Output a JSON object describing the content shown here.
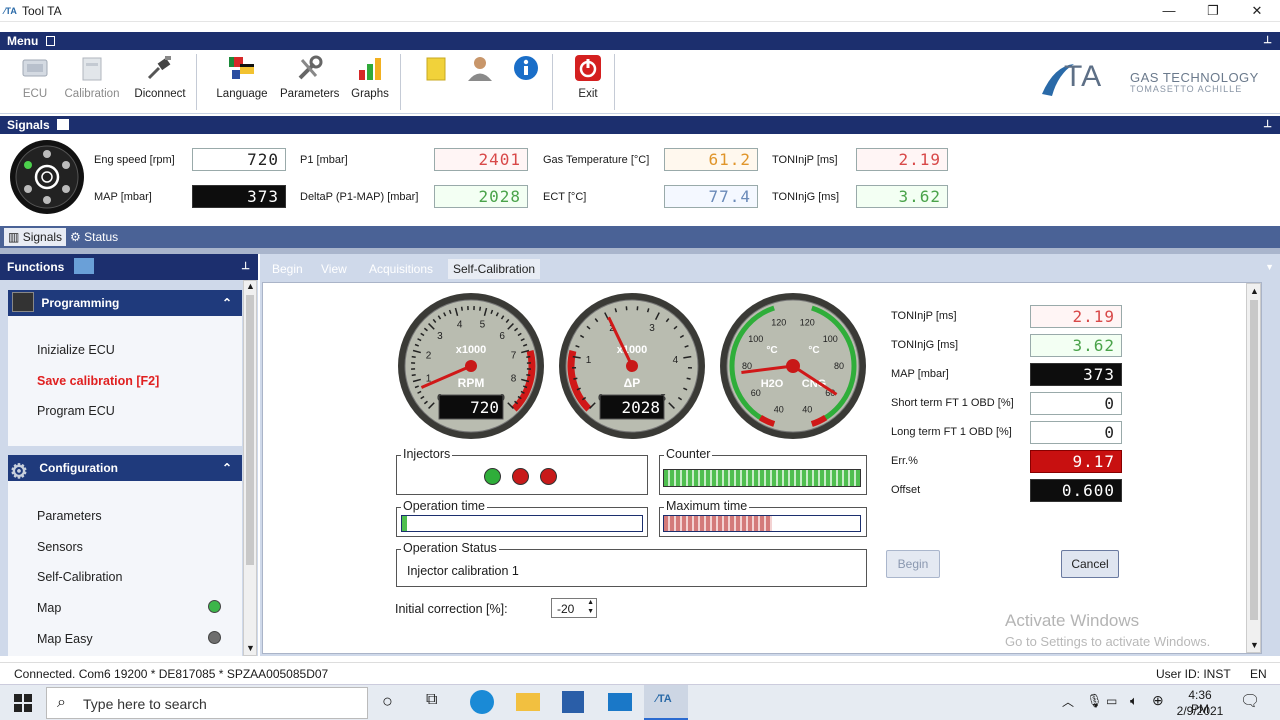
{
  "window": {
    "title": "Tool TA",
    "app_icon": "ta-app-icon"
  },
  "menu": {
    "header": "Menu",
    "tools": [
      {
        "id": "ecu",
        "label": "ECU",
        "icon": "ecu-icon",
        "enabled": false
      },
      {
        "id": "calibration",
        "label": "Calibration",
        "icon": "calibration-icon",
        "enabled": false
      },
      {
        "id": "disconnect",
        "label": "Diconnect",
        "icon": "disconnect-icon",
        "enabled": true
      },
      {
        "id": "language",
        "label": "Language",
        "icon": "language-flags-icon",
        "enabled": true
      },
      {
        "id": "parameters",
        "label": "Parameters",
        "icon": "wrench-icon",
        "enabled": true
      },
      {
        "id": "graphs",
        "label": "Graphs",
        "icon": "bar-graph-icon",
        "enabled": true
      },
      {
        "id": "folder",
        "label": "",
        "icon": "folder-icon",
        "enabled": true
      },
      {
        "id": "user",
        "label": "",
        "icon": "user-icon",
        "enabled": true
      },
      {
        "id": "info",
        "label": "",
        "icon": "info-icon",
        "enabled": true
      },
      {
        "id": "exit",
        "label": "Exit",
        "icon": "power-icon",
        "enabled": true
      }
    ],
    "logo": {
      "mark": "TA",
      "line1": "GAS TECHNOLOGY",
      "line2": "TOMASETTO ACHILLE"
    }
  },
  "signals": {
    "header": "Signals",
    "fields": {
      "eng_speed": {
        "label": "Eng speed [rpm]",
        "value": "720"
      },
      "map": {
        "label": "MAP [mbar]",
        "value": "373"
      },
      "p1": {
        "label": "P1 [mbar]",
        "value": "2401"
      },
      "deltap": {
        "label": "DeltaP (P1-MAP) [mbar]",
        "value": "2028"
      },
      "gas_temp": {
        "label": "Gas Temperature [°C]",
        "value": "61.2"
      },
      "ect": {
        "label": "ECT [°C]",
        "value": "77.4"
      },
      "toninjp": {
        "label": "TONInjP [ms]",
        "value": "2.19"
      },
      "toninjg": {
        "label": "TONInjG [ms]",
        "value": "3.62"
      }
    },
    "tabs": {
      "signals": "Signals",
      "status": "Status"
    }
  },
  "functions": {
    "header": "Functions",
    "programming": {
      "title": "Programming",
      "items": [
        "Inizialize ECU",
        "Save calibration [F2]",
        "Program ECU"
      ]
    },
    "configuration": {
      "title": "Configuration",
      "items": [
        "Parameters",
        "Sensors",
        "Self-Calibration",
        "Map",
        "Map Easy"
      ]
    },
    "status_colors": {
      "map": "#3cb54a",
      "map_easy": "#6e6e6e"
    }
  },
  "main": {
    "tabs": [
      "Begin",
      "View",
      "Acquisitions",
      "Self-Calibration"
    ],
    "gauges": {
      "rpm": {
        "unit": "x1000",
        "label": "RPM",
        "readout": "720",
        "ticks": [
          "0",
          "1",
          "2",
          "3",
          "4",
          "5",
          "6",
          "7",
          "8",
          "9"
        ],
        "fraction": 0.08
      },
      "dp": {
        "unit": "x1000",
        "label": "ΔP",
        "readout": "2028",
        "ticks": [
          "0",
          "1",
          "2",
          "3",
          "4",
          "5"
        ],
        "fraction": 0.405
      },
      "temp": {
        "left_label": "H2O",
        "right_label": "CNG",
        "left_unit": "°C",
        "right_unit": "°C",
        "left_ticks": [
          "40",
          "60",
          "80",
          "100",
          "120"
        ],
        "right_ticks": [
          "40",
          "60",
          "80",
          "100",
          "120"
        ],
        "left_fraction": 0.45,
        "right_fraction": 0.27
      }
    },
    "injectors": {
      "title": "Injectors",
      "lights": [
        "#2fae3a",
        "#c81a1a",
        "#c81a1a"
      ]
    },
    "counter": {
      "title": "Counter",
      "fill_fraction": 1.0
    },
    "operation_time": {
      "title": "Operation time",
      "fill_fraction": 0.02
    },
    "maximum_time": {
      "title": "Maximum time",
      "fill_fraction": 0.55
    },
    "operation_status": {
      "title": "Operation Status",
      "value": "Injector calibration 1"
    },
    "initial_correction": {
      "label": "Initial correction [%]:",
      "value": "-20"
    },
    "readouts": {
      "toninjp": {
        "label": "TONInjP [ms]",
        "value": "2.19"
      },
      "toninjg": {
        "label": "TONInjG [ms]",
        "value": "3.62"
      },
      "map": {
        "label": "MAP [mbar]",
        "value": "373"
      },
      "stft": {
        "label": "Short term FT 1 OBD [%]",
        "value": "0"
      },
      "ltft": {
        "label": "Long term FT 1 OBD [%]",
        "value": "0"
      },
      "err": {
        "label": "Err.%",
        "value": "9.17"
      },
      "offset": {
        "label": "Offset",
        "value": "0.600"
      }
    },
    "buttons": {
      "begin": "Begin",
      "cancel": "Cancel"
    },
    "watermark": {
      "line1": "Activate Windows",
      "line2": "Go to Settings to activate Windows."
    }
  },
  "statusbar": {
    "connection": "Connected. Com6 19200 * DE817085 * SPZAA005085D07",
    "user": "User ID: INST",
    "lang": "EN"
  },
  "taskbar": {
    "search_placeholder": "Type here to search",
    "time": "4:36 PM",
    "date": "2/9/2021"
  }
}
